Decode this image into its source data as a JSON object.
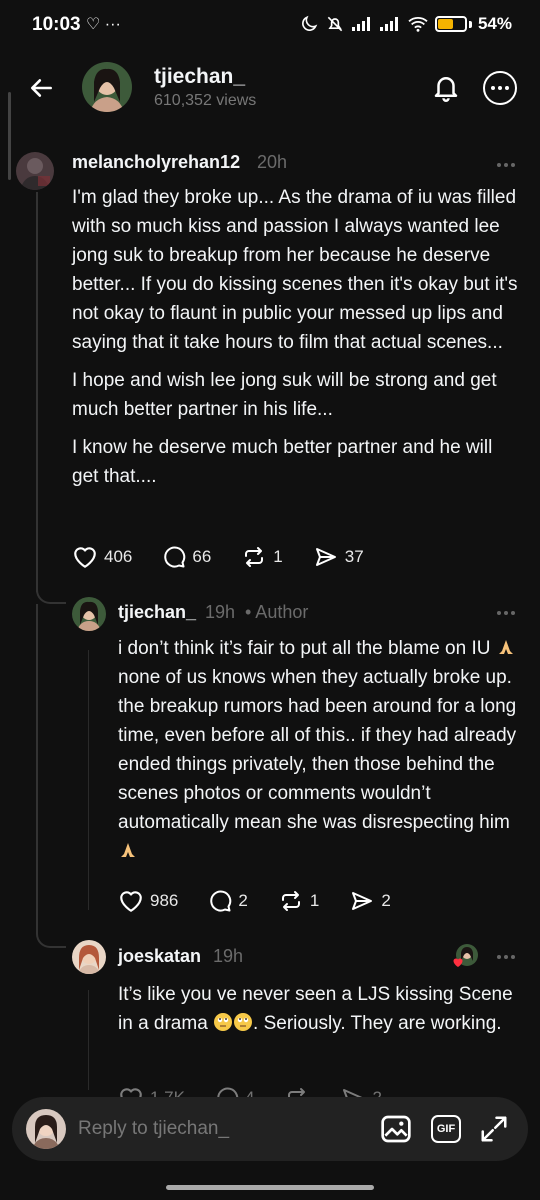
{
  "status_bar": {
    "time": "10:03",
    "left_icons": "♡ ···",
    "battery_percent": "54",
    "battery_label": "54%",
    "battery_level": 0.54
  },
  "header": {
    "username": "tjiechan_",
    "views": "610,352 views"
  },
  "comments": [
    {
      "username": "melancholyrehan12",
      "time": "20h",
      "paragraphs": [
        "I'm glad they broke up... As the drama of iu was filled with so much kiss and passion I always wanted lee jong suk to breakup from her because he deserve better... If you do kissing scenes then it's okay but it's not okay to flaunt in public your messed up lips and saying that it take hours to film that actual scenes...",
        "I hope and wish lee jong suk will be strong and get much better partner in his life...",
        "I know he deserve much better partner and he will get that...."
      ],
      "likes": "406",
      "replies": "66",
      "reposts": "1",
      "shares": "37"
    },
    {
      "username": "tjiechan_",
      "time": "19h",
      "author_tag": "• Author",
      "text_a": "i don’t think it’s fair to put all the blame on IU",
      "text_b": " none of us knows when they actually broke up. the breakup rumors had been around for a long time, even before all of this.. if they had already ended things privately, then those behind the scenes photos or comments wouldn’t automatically mean she was disrespecting him",
      "likes": "986",
      "replies": "2",
      "reposts": "1",
      "shares": "2"
    },
    {
      "username": "joeskatan",
      "time": "19h",
      "text_a": "It’s like you ve never seen a LJS kissing Scene in a drama ",
      "text_b": ". Seriously. They are working.",
      "likes": "1.7K",
      "replies": "4",
      "reposts": "",
      "shares": "2"
    }
  ],
  "reply_bar": {
    "placeholder": "Reply to tjiechan_",
    "gif_label": "GIF"
  },
  "colors": {
    "background": "#101010",
    "text": "#f3f5f7",
    "muted": "#6b6b6b",
    "input_bg": "#222222",
    "liked_heart": "#ff3040",
    "battery": "#f5b400"
  }
}
